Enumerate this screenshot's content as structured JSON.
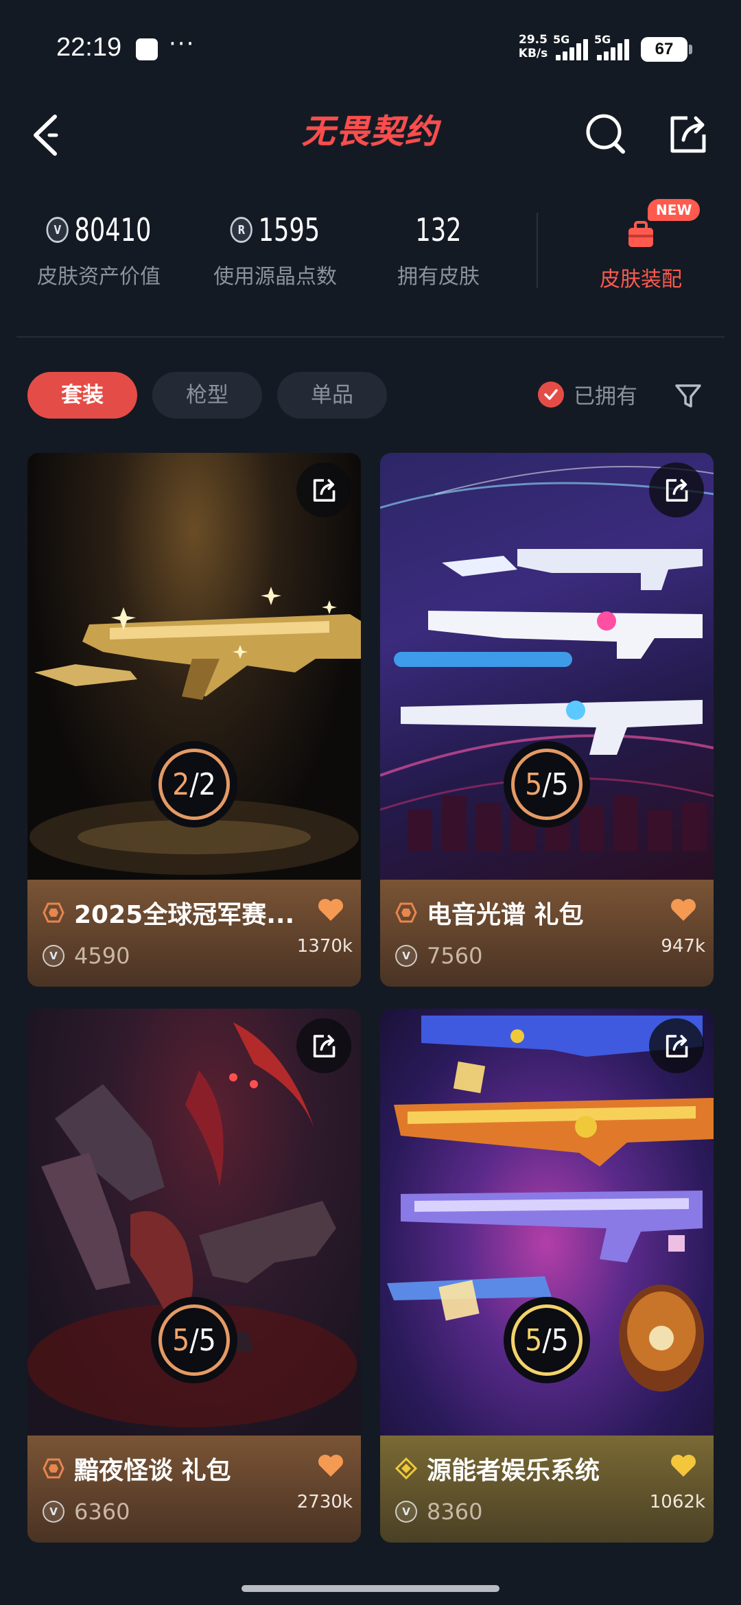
{
  "status_bar": {
    "time": "22:19",
    "dots": "···",
    "net_speed_value": "29.5",
    "net_speed_unit": "KB/s",
    "sim1": "5G",
    "sim2": "5G",
    "battery": "67"
  },
  "header": {
    "logo_text": "无畏契约"
  },
  "stats": {
    "asset_value": "80410",
    "asset_label": "皮肤资产价值",
    "points_value": "1595",
    "points_label": "使用源晶点数",
    "skins_value": "132",
    "skins_label": "拥有皮肤",
    "equip_label": "皮肤装配",
    "new_badge": "NEW"
  },
  "filters": {
    "tabs": [
      {
        "label": "套装",
        "active": true
      },
      {
        "label": "枪型",
        "active": false
      },
      {
        "label": "单品",
        "active": false
      }
    ],
    "owned_label": "已拥有"
  },
  "cards": [
    {
      "title": "2025全球冠军赛...",
      "price": "4590",
      "likes": "1370k",
      "owned": "2",
      "total": "2",
      "tier_color": "#e8864e",
      "heart_color": "#f59a52"
    },
    {
      "title": "电音光谱 礼包",
      "price": "7560",
      "likes": "947k",
      "owned": "5",
      "total": "5",
      "tier_color": "#e8864e",
      "heart_color": "#f59a52"
    },
    {
      "title": "黯夜怪谈 礼包",
      "price": "6360",
      "likes": "2730k",
      "owned": "5",
      "total": "5",
      "tier_color": "#e8864e",
      "heart_color": "#f59a52"
    },
    {
      "title": "源能者娱乐系统",
      "price": "8360",
      "likes": "1062k",
      "owned": "5",
      "total": "5",
      "tier_color": "#f0c93a",
      "heart_color": "#f3c63c"
    }
  ],
  "colors": {
    "background": "#141a24",
    "accent": "#e44d47",
    "muted_text": "#8b929c"
  }
}
